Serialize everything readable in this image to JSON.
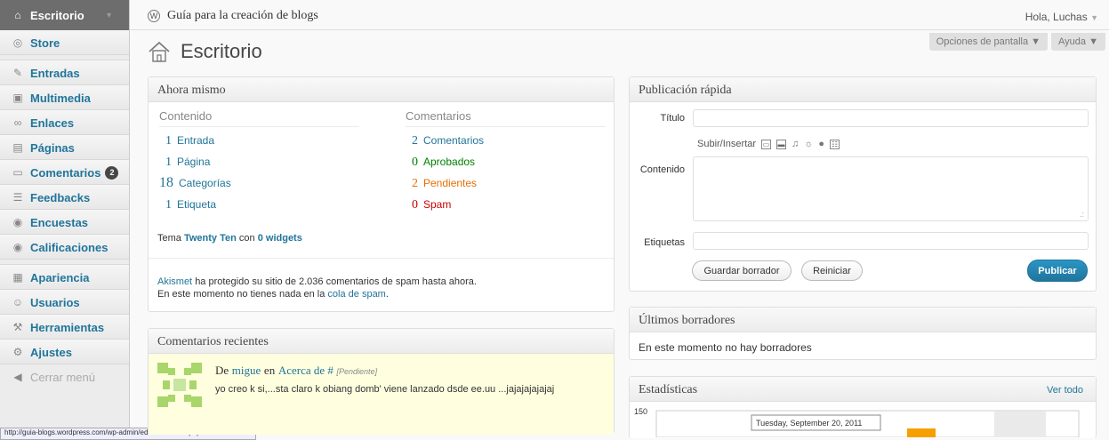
{
  "sidebar": {
    "items": [
      {
        "label": "Escritorio",
        "icon": "home-icon"
      },
      {
        "label": "Store",
        "icon": "store-icon"
      },
      {
        "label": "Entradas",
        "icon": "pin-icon"
      },
      {
        "label": "Multimedia",
        "icon": "media-icon"
      },
      {
        "label": "Enlaces",
        "icon": "link-icon"
      },
      {
        "label": "Páginas",
        "icon": "pages-icon"
      },
      {
        "label": "Comentarios",
        "icon": "comments-icon",
        "badge": "2"
      },
      {
        "label": "Feedbacks",
        "icon": "feedback-icon"
      },
      {
        "label": "Encuestas",
        "icon": "polls-icon"
      },
      {
        "label": "Calificaciones",
        "icon": "ratings-icon"
      },
      {
        "label": "Apariencia",
        "icon": "appearance-icon"
      },
      {
        "label": "Usuarios",
        "icon": "users-icon"
      },
      {
        "label": "Herramientas",
        "icon": "tools-icon"
      },
      {
        "label": "Ajustes",
        "icon": "settings-icon"
      }
    ],
    "collapse_label": "Cerrar menú"
  },
  "header": {
    "site_title": "Guía para la creación de blogs",
    "greeting": "Hola, Luchas",
    "screen_options": "Opciones de pantalla",
    "help": "Ayuda",
    "page_title": "Escritorio"
  },
  "ahora": {
    "title": "Ahora mismo",
    "content_head": "Contenido",
    "comments_head": "Comentarios",
    "content_rows": [
      {
        "n": "1",
        "label": "Entrada"
      },
      {
        "n": "1",
        "label": "Página"
      },
      {
        "n": "18",
        "label": "Categorías"
      },
      {
        "n": "1",
        "label": "Etiqueta"
      }
    ],
    "comment_rows": [
      {
        "n": "2",
        "label": "Comentarios",
        "color": "#21759b"
      },
      {
        "n": "0",
        "label": "Aprobados",
        "color": "#008000"
      },
      {
        "n": "2",
        "label": "Pendientes",
        "color": "#e66f00"
      },
      {
        "n": "0",
        "label": "Spam",
        "color": "#cc0000"
      }
    ],
    "theme_prefix": "Tema",
    "theme_name": "Twenty Ten",
    "theme_mid": "con",
    "widgets": "0 widgets",
    "akismet_link": "Akismet",
    "akismet_text": "ha protegido su sitio de 2.036 comentarios de spam hasta ahora.",
    "spam_text": "En este momento no tienes nada en la",
    "spam_link": "cola de spam",
    "spam_end": "."
  },
  "recent": {
    "title": "Comentarios recientes",
    "by": "De",
    "author": "migue",
    "on": "en",
    "post": "Acerca de #",
    "status": "[Pendiente]",
    "text": "yo creo k si,...sta claro k obiang domb' viene lanzado dsde ee.uu ...jajajajajajaj"
  },
  "quick": {
    "title": "Publicación rápida",
    "title_label": "Título",
    "upload_label": "Subir/Insertar",
    "content_label": "Contenido",
    "tags_label": "Etiquetas",
    "save": "Guardar borrador",
    "reset": "Reiniciar",
    "publish": "Publicar"
  },
  "drafts": {
    "title": "Últimos borradores",
    "empty": "En este momento no hay borradores"
  },
  "stats": {
    "title": "Estadísticas",
    "view_all": "Ver todo",
    "y_tick": "150",
    "tooltip": "Tuesday, September 20, 2011"
  },
  "statusbar": "http://guia-blogs.wordpress.com/wp-admin/edit-comments.php"
}
